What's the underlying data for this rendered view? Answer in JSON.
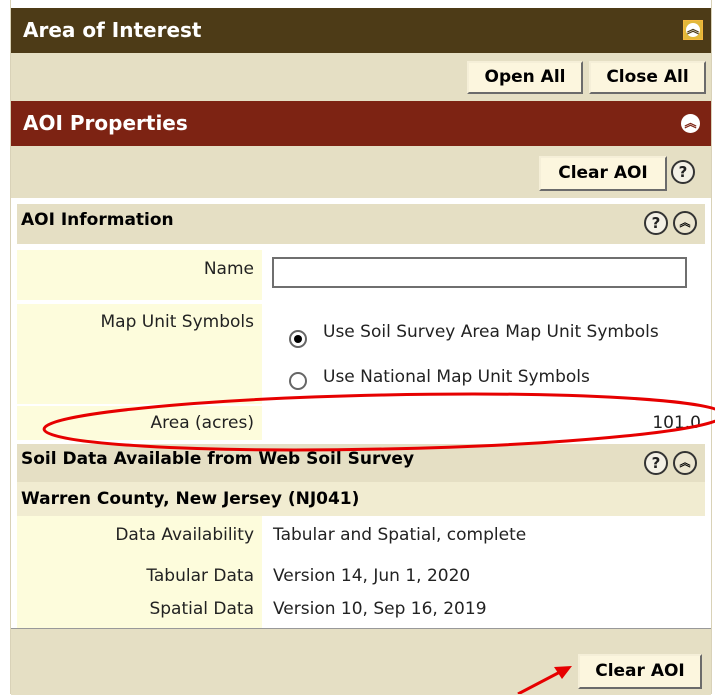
{
  "area_of_interest": {
    "title": "Area of Interest",
    "open_all": "Open All",
    "close_all": "Close All"
  },
  "aoi_properties": {
    "title": "AOI Properties",
    "clear_label": "Clear AOI",
    "help": "?"
  },
  "aoi_information": {
    "title": "AOI Information",
    "name_label": "Name",
    "name_value": "",
    "map_unit_label": "Map Unit Symbols",
    "option_1": "Use Soil Survey Area Map Unit Symbols",
    "option_2": "Use National Map Unit Symbols",
    "selected_option": "option_1",
    "area_label": "Area (acres)",
    "area_value": "101.0"
  },
  "soil_data": {
    "title": "Soil Data Available from Web Soil Survey",
    "county": "Warren County, New Jersey (NJ041)",
    "rows": [
      {
        "label": "Data Availability",
        "value": "Tabular and Spatial, complete"
      },
      {
        "label": "Tabular Data",
        "value": "Version 14, Jun 1, 2020"
      },
      {
        "label": "Spatial Data",
        "value": "Version 10, Sep 16, 2019"
      }
    ]
  },
  "bottom": {
    "clear_label": "Clear AOI"
  },
  "annotation_color": "#e60000",
  "icons": [
    "collapse-up-icon",
    "help-icon",
    "radio-selected-icon",
    "radio-unselected-icon",
    "red-ellipse-annotation",
    "red-arrow-annotation"
  ]
}
